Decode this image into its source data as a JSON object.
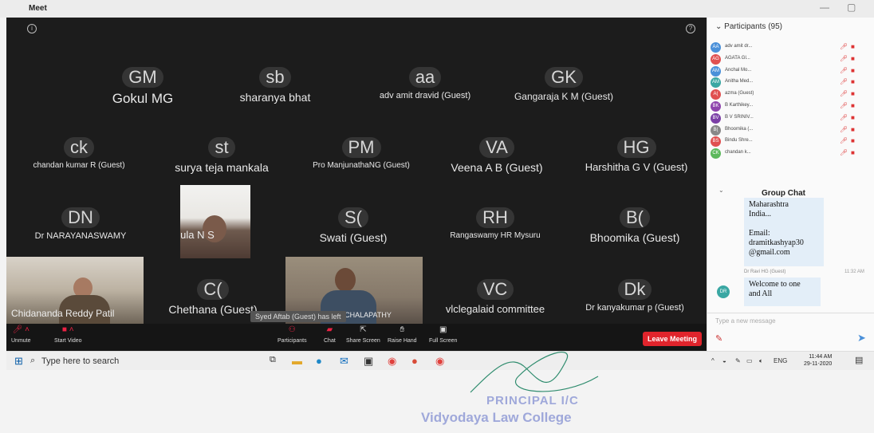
{
  "window": {
    "app_title": "Meet",
    "minimize": "—",
    "maximize": "▢"
  },
  "video": {
    "info_icon": "info-icon",
    "help_icon": "help-icon",
    "tiles": [
      {
        "initials": "GM",
        "name": "Gokul MG"
      },
      {
        "initials": "sb",
        "name": "sharanya bhat"
      },
      {
        "initials": "aa",
        "name": "adv amit dravid (Guest)"
      },
      {
        "initials": "GK",
        "name": "Gangaraja K M (Guest)"
      },
      {
        "initials": "ck",
        "name": "chandan kumar R (Guest)"
      },
      {
        "initials": "st",
        "name": "surya teja mankala"
      },
      {
        "initials": "PM",
        "name": "Pro ManjunathaNG (Guest)"
      },
      {
        "initials": "VA",
        "name": "Veena A B (Guest)"
      },
      {
        "initials": "HG",
        "name": "Harshitha G V (Guest)"
      },
      {
        "initials": "DN",
        "name": "Dr NARAYANASWAMY"
      },
      {
        "initials": "S(",
        "name": "Swati (Guest)"
      },
      {
        "initials": "RH",
        "name": "Rangaswamy HR Mysuru"
      },
      {
        "initials": "B(",
        "name": "Bhoomika (Guest)"
      },
      {
        "initials": "C(",
        "name": "Chethana (Guest)"
      },
      {
        "initials": "VC",
        "name": "vlclegalaid committee"
      },
      {
        "initials": "Dk",
        "name": "Dr kanyakumar p (Guest)"
      }
    ],
    "photos": [
      {
        "name": "Manjula N S"
      },
      {
        "name": "Chidananda Reddy Patil"
      },
      {
        "name": "PROF VENKATACHALAPATHY"
      }
    ],
    "toast": "Syed Aftab (Guest) has left"
  },
  "toolbar": {
    "unmute": "Unmute",
    "start_video": "Start Video",
    "participants": "Participants",
    "chat": "Chat",
    "share_screen": "Share Screen",
    "raise_hand": "Raise Hand",
    "full_screen": "Full Screen",
    "leave": "Leave Meeting"
  },
  "participants_panel": {
    "header": "Participants (95)",
    "items": [
      {
        "initials": "AA",
        "name": "adv amit dr...",
        "color": "#4a90d9"
      },
      {
        "initials": "AG",
        "name": "AGATA Gl...",
        "color": "#e05050"
      },
      {
        "initials": "AM",
        "name": "Anchal Mo...",
        "color": "#4a90d9"
      },
      {
        "initials": "AM",
        "name": "Anitha Med...",
        "color": "#3aa7a3"
      },
      {
        "initials": "A(",
        "name": "azma (Guest)",
        "color": "#e05050"
      },
      {
        "initials": "BK",
        "name": "B Karthikey...",
        "color": "#8e44ad"
      },
      {
        "initials": "BV",
        "name": "B V SRINIV...",
        "color": "#7b3fa6"
      },
      {
        "initials": "B(",
        "name": "Bhoomika (...",
        "color": "#888888"
      },
      {
        "initials": "BS",
        "name": "Bindu Shre...",
        "color": "#e05050"
      },
      {
        "initials": "CK",
        "name": "chandan k...",
        "color": "#5cb85c"
      }
    ]
  },
  "group_chat": {
    "title": "Group Chat",
    "message1": [
      "Maharashtra",
      "India...",
      "",
      "Email:",
      "dramitkashyap30",
      "@gmail.com"
    ],
    "sender2": "Dr Ravi HG (Guest)",
    "time2": "11:32 AM",
    "sender2_initials": "DR",
    "message2": [
      "Welcome to one",
      "and All"
    ],
    "input_placeholder": "Type a new message"
  },
  "taskbar": {
    "search_placeholder": "Type here to search",
    "language": "ENG",
    "time": "11:44 AM",
    "date": "29-11-2020"
  },
  "stamp": {
    "line1": "PRINCIPAL I/C",
    "line2": "Vidyodaya Law College"
  }
}
